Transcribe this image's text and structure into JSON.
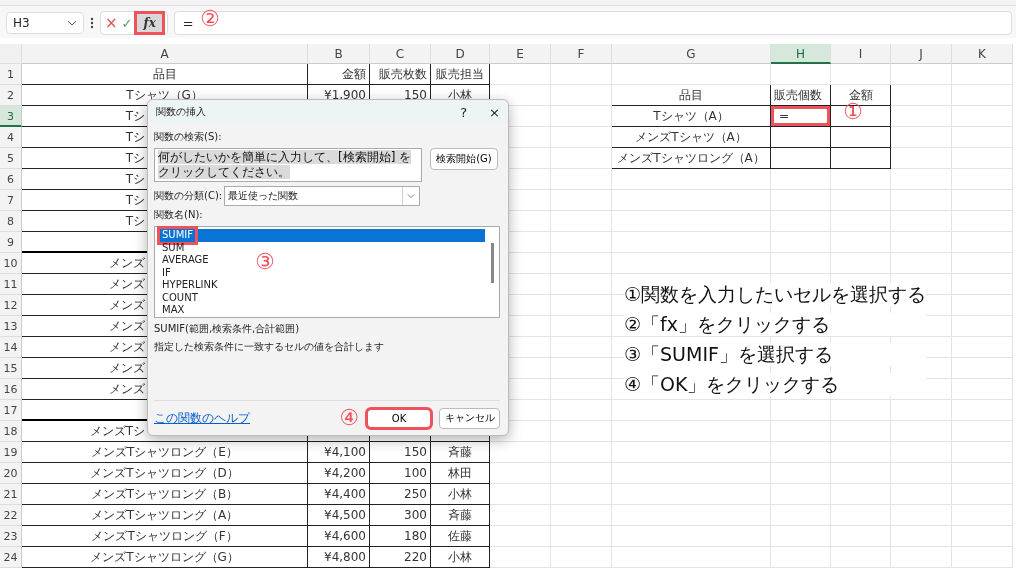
{
  "formula_bar": {
    "name_box": "H3",
    "cancel": "×",
    "enter": "✓",
    "fx": {
      "label": "fx",
      "highlight": true
    },
    "formula": "=",
    "marker": "②"
  },
  "sheet": {
    "columns": [
      {
        "label": "A",
        "selected": false
      },
      {
        "label": "B",
        "selected": false
      },
      {
        "label": "C",
        "selected": false
      },
      {
        "label": "D",
        "selected": false
      },
      {
        "label": "E",
        "selected": false
      },
      {
        "label": "F",
        "selected": false
      },
      {
        "label": "G",
        "selected": false
      },
      {
        "label": "H",
        "selected": true
      },
      {
        "label": "I",
        "selected": false
      },
      {
        "label": "J",
        "selected": false
      },
      {
        "label": "K",
        "selected": false
      }
    ],
    "rows": [
      {
        "number": "1",
        "selected": false,
        "clipped": false,
        "cells": {
          "A": "品目",
          "B": "金額",
          "C": "販売枚数",
          "D": "販売担当"
        }
      },
      {
        "number": "2",
        "selected": false,
        "clipped": false,
        "cells": {
          "A": "Tシャツ（G）",
          "B": "¥1,900",
          "C": "150",
          "D": "小林",
          "G": "品目",
          "H": "販売個数",
          "I": "金額"
        }
      },
      {
        "number": "3",
        "selected": true,
        "clipped": true,
        "highlight": true,
        "cells": {
          "A": "Tシ",
          "G": "Tシャツ（A）",
          "H": "="
        }
      },
      {
        "number": "4",
        "selected": false,
        "clipped": true,
        "cells": {
          "A": "Tシ",
          "G": "メンズTシャツ（A）"
        }
      },
      {
        "number": "5",
        "selected": false,
        "clipped": true,
        "cells": {
          "A": "Tシ",
          "G": "メンズTシャツロング（A）"
        }
      },
      {
        "number": "6",
        "selected": false,
        "clipped": true,
        "cells": {
          "A": "Tシ"
        }
      },
      {
        "number": "7",
        "selected": false,
        "clipped": true,
        "cells": {
          "A": "Tシ"
        }
      },
      {
        "number": "8",
        "selected": false,
        "clipped": true,
        "cells": {
          "A": "Tシ"
        }
      },
      {
        "number": "9",
        "selected": false,
        "clipped": true,
        "cells": {}
      },
      {
        "number": "10",
        "selected": false,
        "clipped": true,
        "cells": {
          "A": "メンズ"
        }
      },
      {
        "number": "11",
        "selected": false,
        "clipped": true,
        "cells": {
          "A": "メンズ"
        }
      },
      {
        "number": "12",
        "selected": false,
        "clipped": true,
        "cells": {
          "A": "メンズ"
        }
      },
      {
        "number": "13",
        "selected": false,
        "clipped": true,
        "cells": {
          "A": "メンズ"
        }
      },
      {
        "number": "14",
        "selected": false,
        "clipped": true,
        "cells": {
          "A": "メンズ"
        }
      },
      {
        "number": "15",
        "selected": false,
        "clipped": true,
        "cells": {
          "A": "メンズ"
        }
      },
      {
        "number": "16",
        "selected": false,
        "clipped": true,
        "cells": {
          "A": "メンズ"
        }
      },
      {
        "number": "17",
        "selected": false,
        "clipped": true,
        "cells": {}
      },
      {
        "number": "18",
        "selected": false,
        "clipped": true,
        "cells": {
          "A": "メンズTシ"
        }
      },
      {
        "number": "19",
        "selected": false,
        "clipped": false,
        "cells": {
          "A": "メンズTシャツロング（E）",
          "B": "¥4,100",
          "C": "150",
          "D": "斉藤"
        }
      },
      {
        "number": "20",
        "selected": false,
        "clipped": false,
        "cells": {
          "A": "メンズTシャツロング（D）",
          "B": "¥4,200",
          "C": "100",
          "D": "林田"
        }
      },
      {
        "number": "21",
        "selected": false,
        "clipped": false,
        "cells": {
          "A": "メンズTシャツロング（B）",
          "B": "¥4,400",
          "C": "250",
          "D": "小林"
        }
      },
      {
        "number": "22",
        "selected": false,
        "clipped": false,
        "cells": {
          "A": "メンズTシャツロング（A）",
          "B": "¥4,500",
          "C": "300",
          "D": "斉藤"
        }
      },
      {
        "number": "23",
        "selected": false,
        "clipped": false,
        "cells": {
          "A": "メンズTシャツロング（F）",
          "B": "¥4,600",
          "C": "180",
          "D": "佐藤"
        }
      },
      {
        "number": "24",
        "selected": false,
        "clipped": false,
        "cells": {
          "A": "メンズTシャツロング（G）",
          "B": "¥4,800",
          "C": "220",
          "D": "小林"
        }
      }
    ],
    "marker": "①"
  },
  "dialog": {
    "title": "関数の挿入",
    "help": "?",
    "close": "×",
    "search_label": "関数の検索(S):",
    "search_value": "何がしたいかを簡単に入力して、[検索開始] をクリックしてください。",
    "search_button": "検索開始(G)",
    "category_label": "関数の分類(C):",
    "category_value": "最近使った関数",
    "list_label": "関数名(N):",
    "functions": [
      {
        "name": "SUMIF",
        "selected": true,
        "highlight": true
      },
      {
        "name": "SUM",
        "selected": false,
        "highlight": false
      },
      {
        "name": "AVERAGE",
        "selected": false,
        "highlight": false
      },
      {
        "name": "IF",
        "selected": false,
        "highlight": false
      },
      {
        "name": "HYPERLINK",
        "selected": false,
        "highlight": false
      },
      {
        "name": "COUNT",
        "selected": false,
        "highlight": false
      },
      {
        "name": "MAX",
        "selected": false,
        "highlight": false
      }
    ],
    "list_marker": "③",
    "syntax": "SUMIF(範囲,検索条件,合計範囲)",
    "description": "指定した検索条件に一致するセルの値を合計します",
    "help_link": "この関数のヘルプ",
    "footer_marker": "④",
    "ok": {
      "label": "OK",
      "highlight": true
    },
    "cancel": "キャンセル"
  },
  "instructions": [
    "①関数を入力したいセルを選択する",
    "②「fx」をクリックする",
    "③「SUMIF」を選択する",
    "④「OK」をクリックする"
  ]
}
